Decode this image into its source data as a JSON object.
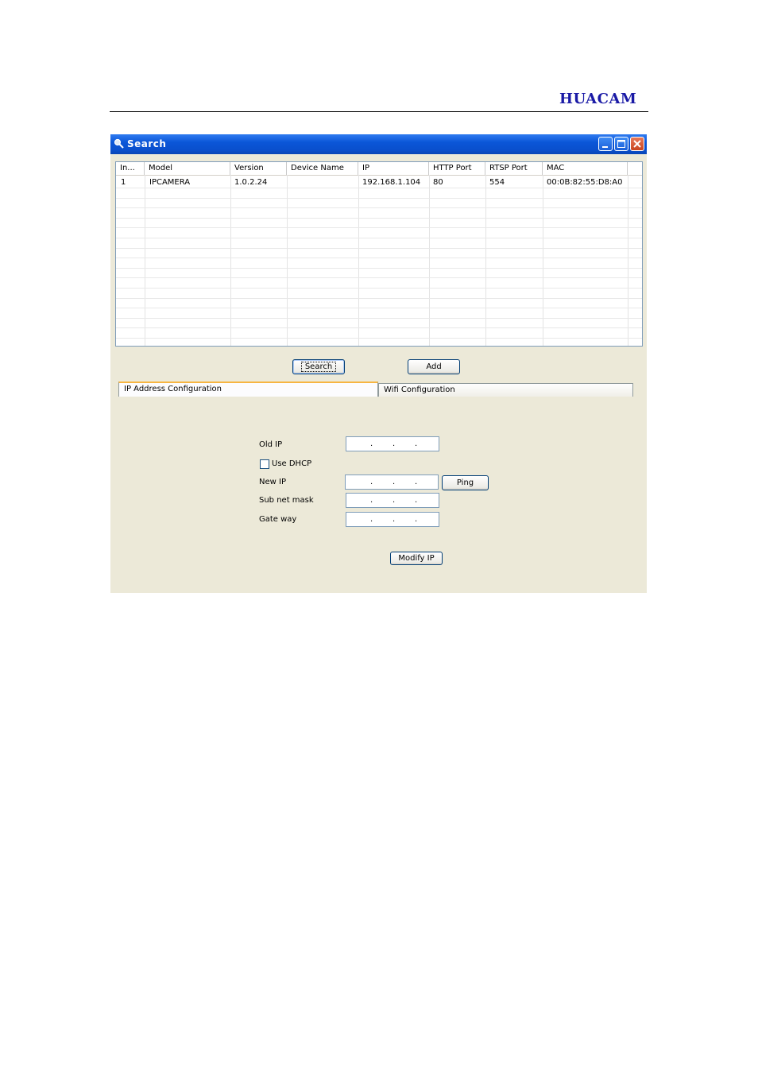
{
  "header": {
    "brand": "HUACAM"
  },
  "window": {
    "title": "Search"
  },
  "table": {
    "columns": [
      "In...",
      "Model",
      "Version",
      "Device Name",
      "IP",
      "HTTP Port",
      "RTSP Port",
      "MAC"
    ],
    "rows": [
      [
        "1",
        "IPCAMERA",
        "1.0.2.24",
        "",
        "192.168.1.104",
        "80",
        "554",
        "00:0B:82:55:D8:A0"
      ]
    ]
  },
  "buttons": {
    "search": "Search",
    "add": "Add",
    "ping": "Ping",
    "modify_ip": "Modify IP"
  },
  "tabs": {
    "ip_config": "IP Address Configuration",
    "wifi_config": "Wifi Configuration"
  },
  "form": {
    "old_ip": "Old IP",
    "use_dhcp": "Use DHCP",
    "new_ip": "New IP",
    "subnet_mask": "Sub net mask",
    "gateway": "Gate way",
    "use_dhcp_checked": false
  },
  "colors": {
    "brand": "#1a1aa6",
    "titlebar": "#0b56d8",
    "window_bg": "#ece9d8",
    "active_tab_accent": "#f7b541"
  }
}
